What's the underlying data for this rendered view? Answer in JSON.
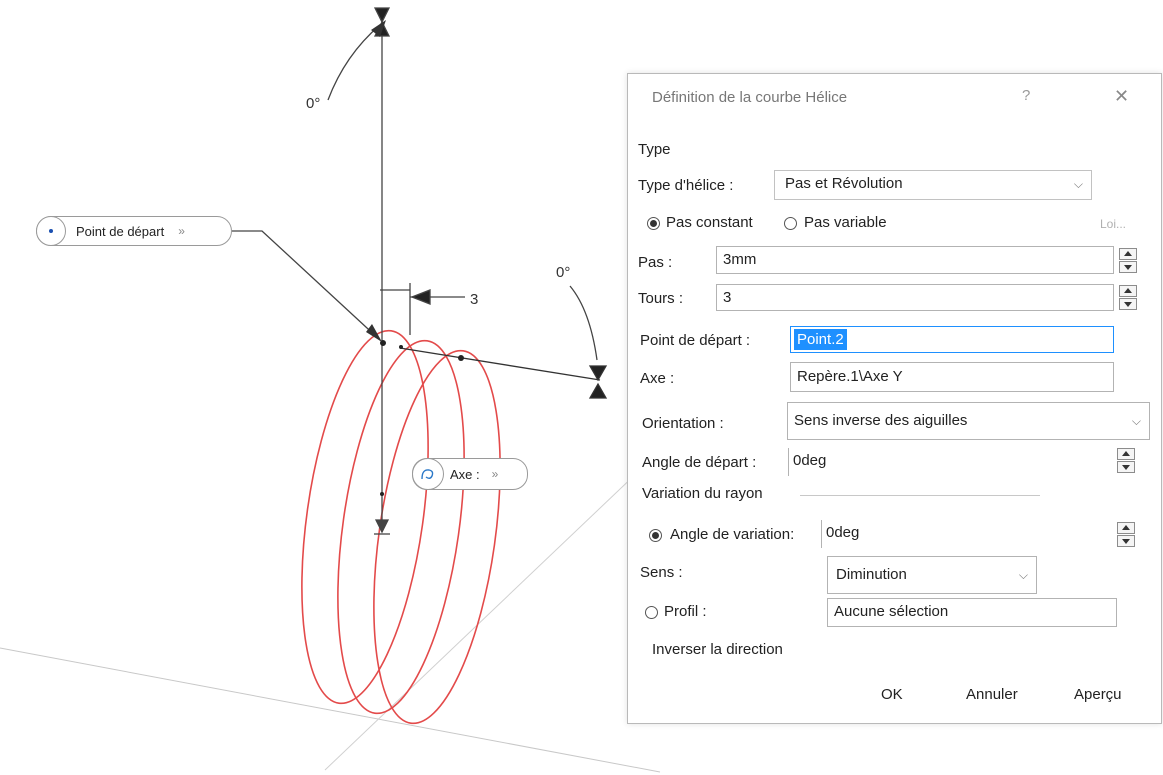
{
  "viewport": {
    "angle_label_top": "0°",
    "angle_label_right": "0°",
    "dimension_value": "3",
    "callout_start_point": {
      "label": "Point de départ",
      "chevron": "»",
      "icon": "point-icon"
    },
    "callout_axis": {
      "label": "Axe :",
      "chevron": "»",
      "icon": "axis-icon"
    },
    "helix_color": "#e34a4a"
  },
  "dialog": {
    "title": "Définition de la courbe Hélice",
    "help_glyph": "?",
    "close_glyph": "✕",
    "section_type": "Type",
    "helix_type_label": "Type d'hélice :",
    "helix_type_value": "Pas et Révolution",
    "pitch_mode": {
      "constant_label": "Pas constant",
      "variable_label": "Pas variable",
      "selected": "constant"
    },
    "law_button": "Loi...",
    "pitch_label": "Pas :",
    "pitch_value": "3mm",
    "turns_label": "Tours :",
    "turns_value": "3",
    "start_point_label": "Point de départ :",
    "start_point_value": "Point.2",
    "axis_label": "Axe :",
    "axis_value": "Repère.1\\Axe Y",
    "orientation_label": "Orientation :",
    "orientation_value": "Sens inverse des aiguilles",
    "start_angle_label": "Angle de départ :",
    "start_angle_value": "0deg",
    "radius_section": "Variation du rayon",
    "variation_angle_label": "Angle de variation:",
    "variation_angle_value": "0deg",
    "direction_label": "Sens :",
    "direction_value": "Diminution",
    "profile_label": "Profil :",
    "profile_value": "Aucune sélection",
    "reverse_label": "Inverser la direction",
    "ok": "OK",
    "cancel": "Annuler",
    "preview": "Aperçu",
    "selection_color": "#1e90ff"
  }
}
